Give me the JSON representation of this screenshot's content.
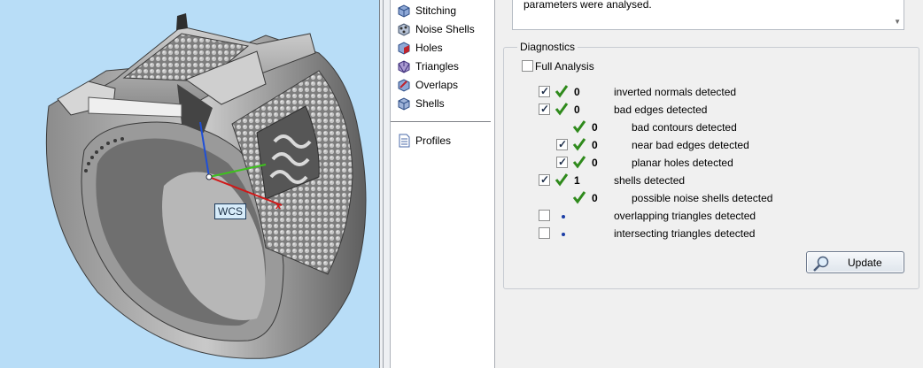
{
  "viewport": {
    "wcs_label": "WCS",
    "axis_x_label": "x"
  },
  "tree": {
    "items": [
      {
        "label": "Stitching",
        "icon": "stitching-icon"
      },
      {
        "label": "Noise Shells",
        "icon": "noise-shells-icon"
      },
      {
        "label": "Holes",
        "icon": "holes-icon"
      },
      {
        "label": "Triangles",
        "icon": "triangles-icon"
      },
      {
        "label": "Overlaps",
        "icon": "overlaps-icon"
      },
      {
        "label": "Shells",
        "icon": "shells-icon"
      }
    ],
    "profiles_label": "Profiles"
  },
  "message": {
    "text": "parameters were analysed."
  },
  "diagnostics": {
    "title": "Diagnostics",
    "full_analysis_label": "Full Analysis",
    "full_analysis_checked": false,
    "rows": [
      {
        "checked": true,
        "status": "ok",
        "count": "0",
        "label": "inverted normals detected",
        "indent": 0
      },
      {
        "checked": true,
        "status": "ok",
        "count": "0",
        "label": "bad edges detected",
        "indent": 0
      },
      {
        "checkbox": false,
        "status": "ok",
        "count": "0",
        "label": "bad contours detected",
        "indent": 1
      },
      {
        "checked": true,
        "status": "ok",
        "count": "0",
        "label": "near bad edges detected",
        "indent": 1
      },
      {
        "checked": true,
        "status": "ok",
        "count": "0",
        "label": "planar holes detected",
        "indent": 1
      },
      {
        "checked": true,
        "status": "ok",
        "count": "1",
        "label": "shells detected",
        "indent": 0
      },
      {
        "checkbox": false,
        "status": "ok",
        "count": "0",
        "label": "possible noise shells detected",
        "indent": 1
      },
      {
        "checked": false,
        "status": "pending",
        "count": "",
        "label": "overlapping triangles detected",
        "indent": 0
      },
      {
        "checked": false,
        "status": "pending",
        "count": "",
        "label": "intersecting triangles detected",
        "indent": 0
      }
    ],
    "update_label": "Update"
  },
  "colors": {
    "viewport_bg": "#b8ddf7",
    "check_green": "#2f8a1c",
    "axis_x": "#d01818",
    "axis_y": "#3ec21e",
    "axis_z": "#1e4fd8"
  }
}
